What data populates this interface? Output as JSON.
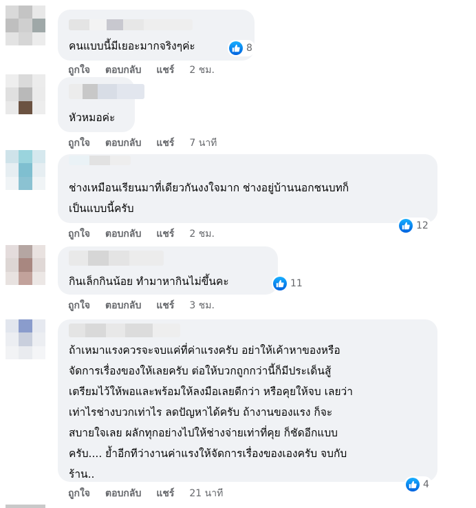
{
  "actions": {
    "like": "ถูกใจ",
    "reply": "ตอบกลับ",
    "share": "แชร์"
  },
  "comments": [
    {
      "text": "คนแบบนี้มีเยอะมากจริงๆค่ะ",
      "likes": "8",
      "time": "2 ชม."
    },
    {
      "text": "หัวหมอค่ะ",
      "likes": "",
      "time": "7 นาที"
    },
    {
      "text": "ช่างเหมือนเรียนมาที่เดียวกันงงใจมาก ช่างอยู่บ้านนอกชนบทก็\nเป็นแบบนี้ครับ",
      "likes": "12",
      "time": "2 ชม."
    },
    {
      "text": "กินเล็กกินน้อย ทำมาหากินไม่ขึ้นคะ",
      "likes": "11",
      "time": "3 ชม."
    },
    {
      "text": "ถ้าเหมาแรงควรจะจบแค่ที่ค่าแรงครับ อย่าให้เค้าหาของหรือ\nจัดการเรื่องของให้เลยครับ ต่อให้บวกถูกกว่านี้ก็มีประเด็นสู้\nเตรียมไว้ให้พอและพร้อมให้ลงมือเลยดีกว่า หรือคุยให้จบ เลยว่า\nเท่าไรช่างบวกเท่าไร ลดปัญหาได้ครับ ถ้างานของแรง ก็จะ\nสบายใจเลย ผลักทุกอย่างไปให้ช่างจ่ายเท่าที่คุย ก็ชัดอีกแบบ\nครับ.... ย้ำอีกทีว่างานค่าแรงให้จัดการเรื่องของเองครับ จบกับ\nร้าน..",
      "likes": "4",
      "time": "21 นาที"
    }
  ],
  "colors": {
    "bubble": "#f0f2f5",
    "accent": "#1877f2",
    "meta": "#65676b"
  },
  "icons": {
    "reaction": "like-thumb-icon"
  }
}
